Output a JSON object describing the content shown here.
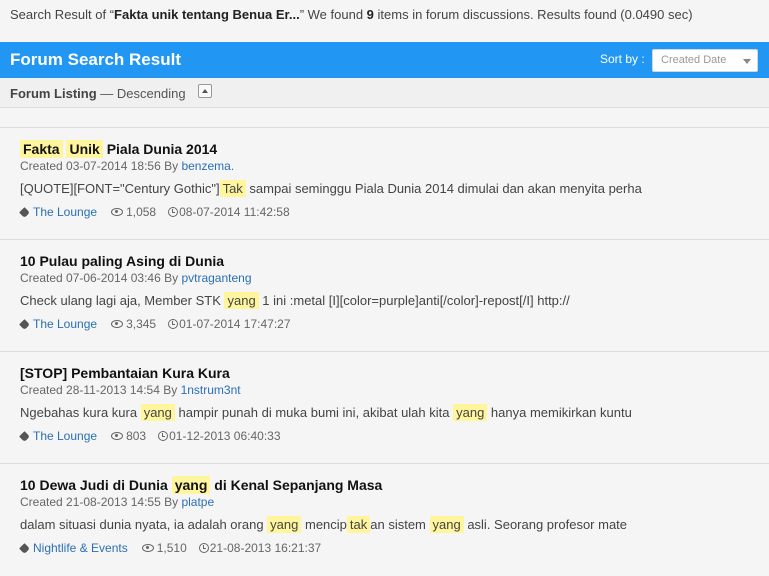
{
  "summary": {
    "prefix": "Search Result of “",
    "query": "Fakta unik tentang Benua Er...",
    "mid": "” We found ",
    "count": "9",
    "suffix": " items in forum discussions. Results found (0.0490 sec)"
  },
  "header": {
    "title": "Forum Search Result",
    "sort_label": "Sort by :",
    "sort_value": "Created Date"
  },
  "listing": {
    "label": "Forum Listing",
    "order": " — Descending"
  },
  "results": [
    {
      "title_parts": [
        {
          "t": "Fakta",
          "h": true
        },
        {
          "t": " ",
          "h": false
        },
        {
          "t": "Unik",
          "h": true
        },
        {
          "t": " Piala Dunia 2014",
          "h": false
        }
      ],
      "created": "Created 03-07-2014 18:56 By ",
      "user": "benzema.",
      "snippet_parts": [
        {
          "t": "[QUOTE][FONT=\"Century Gothic\"]",
          "h": false
        },
        {
          "t": "Tak",
          "h": true
        },
        {
          "t": " sampai seminggu Piala Dunia 2014 dimulai dan akan menyita perha",
          "h": false
        }
      ],
      "category": "The Lounge",
      "views": "1,058",
      "last_post": "08-07-2014 11:42:58"
    },
    {
      "title_parts": [
        {
          "t": "10 Pulau paling Asing di Dunia",
          "h": false
        }
      ],
      "created": "Created 07-06-2014 03:46 By ",
      "user": "pvtraganteng",
      "snippet_parts": [
        {
          "t": "Check ulang lagi aja, Member STK ",
          "h": false
        },
        {
          "t": "yang",
          "h": true
        },
        {
          "t": " 1 ini :metal [I][color=purple]anti[/color]-repost[/I] http://",
          "h": false
        }
      ],
      "category": "The Lounge",
      "views": "3,345",
      "last_post": "01-07-2014 17:47:27"
    },
    {
      "title_parts": [
        {
          "t": "[STOP] Pembantaian Kura Kura",
          "h": false
        }
      ],
      "created": "Created 28-11-2013 14:54 By ",
      "user": "1nstrum3nt",
      "snippet_parts": [
        {
          "t": "Ngebahas kura kura ",
          "h": false
        },
        {
          "t": "yang",
          "h": true
        },
        {
          "t": " hampir punah di muka bumi ini, akibat ulah kita ",
          "h": false
        },
        {
          "t": "yang",
          "h": true
        },
        {
          "t": " hanya memikirkan kuntu",
          "h": false
        }
      ],
      "category": "The Lounge",
      "views": "803",
      "last_post": "01-12-2013 06:40:33"
    },
    {
      "title_parts": [
        {
          "t": "10 Dewa Judi di Dunia ",
          "h": false
        },
        {
          "t": "yang",
          "h": true
        },
        {
          "t": " di Kenal Sepanjang Masa",
          "h": false
        }
      ],
      "created": "Created 21-08-2013 14:55 By ",
      "user": "platpe",
      "snippet_parts": [
        {
          "t": "dalam situasi dunia nyata, ia adalah orang ",
          "h": false
        },
        {
          "t": "yang",
          "h": true
        },
        {
          "t": " mencip",
          "h": false
        },
        {
          "t": "tak",
          "h": true
        },
        {
          "t": "an sistem ",
          "h": false
        },
        {
          "t": "yang",
          "h": true
        },
        {
          "t": " asli. Seorang profesor mate",
          "h": false
        }
      ],
      "category": "Nightlife & Events",
      "views": "1,510",
      "last_post": "21-08-2013 16:21:37"
    }
  ]
}
